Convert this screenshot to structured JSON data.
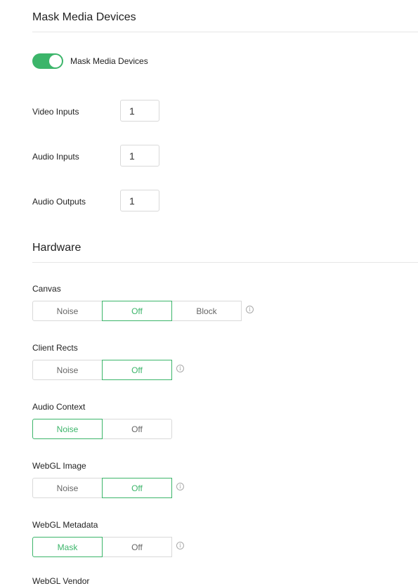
{
  "mask_media": {
    "title": "Mask Media Devices",
    "toggle_label": "Mask Media Devices",
    "toggle_on": true,
    "fields": [
      {
        "label": "Video Inputs",
        "value": "1"
      },
      {
        "label": "Audio Inputs",
        "value": "1"
      },
      {
        "label": "Audio Outputs",
        "value": "1"
      }
    ]
  },
  "hardware": {
    "title": "Hardware",
    "groups": [
      {
        "label": "Canvas",
        "options": [
          "Noise",
          "Off",
          "Block"
        ],
        "selected": "Off",
        "info": true
      },
      {
        "label": "Client Rects",
        "options": [
          "Noise",
          "Off"
        ],
        "selected": "Off",
        "info": true
      },
      {
        "label": "Audio Context",
        "options": [
          "Noise",
          "Off"
        ],
        "selected": "Noise",
        "info": false
      },
      {
        "label": "WebGL Image",
        "options": [
          "Noise",
          "Off"
        ],
        "selected": "Off",
        "info": true
      },
      {
        "label": "WebGL Metadata",
        "options": [
          "Mask",
          "Off"
        ],
        "selected": "Mask",
        "info": true
      }
    ],
    "next_label_cut": "WebGL Vendor"
  },
  "colors": {
    "accent": "#3cb56a",
    "border": "#d9d9d9",
    "info": "#a8a8a8"
  },
  "icons": {
    "info": "info-circle-icon"
  }
}
